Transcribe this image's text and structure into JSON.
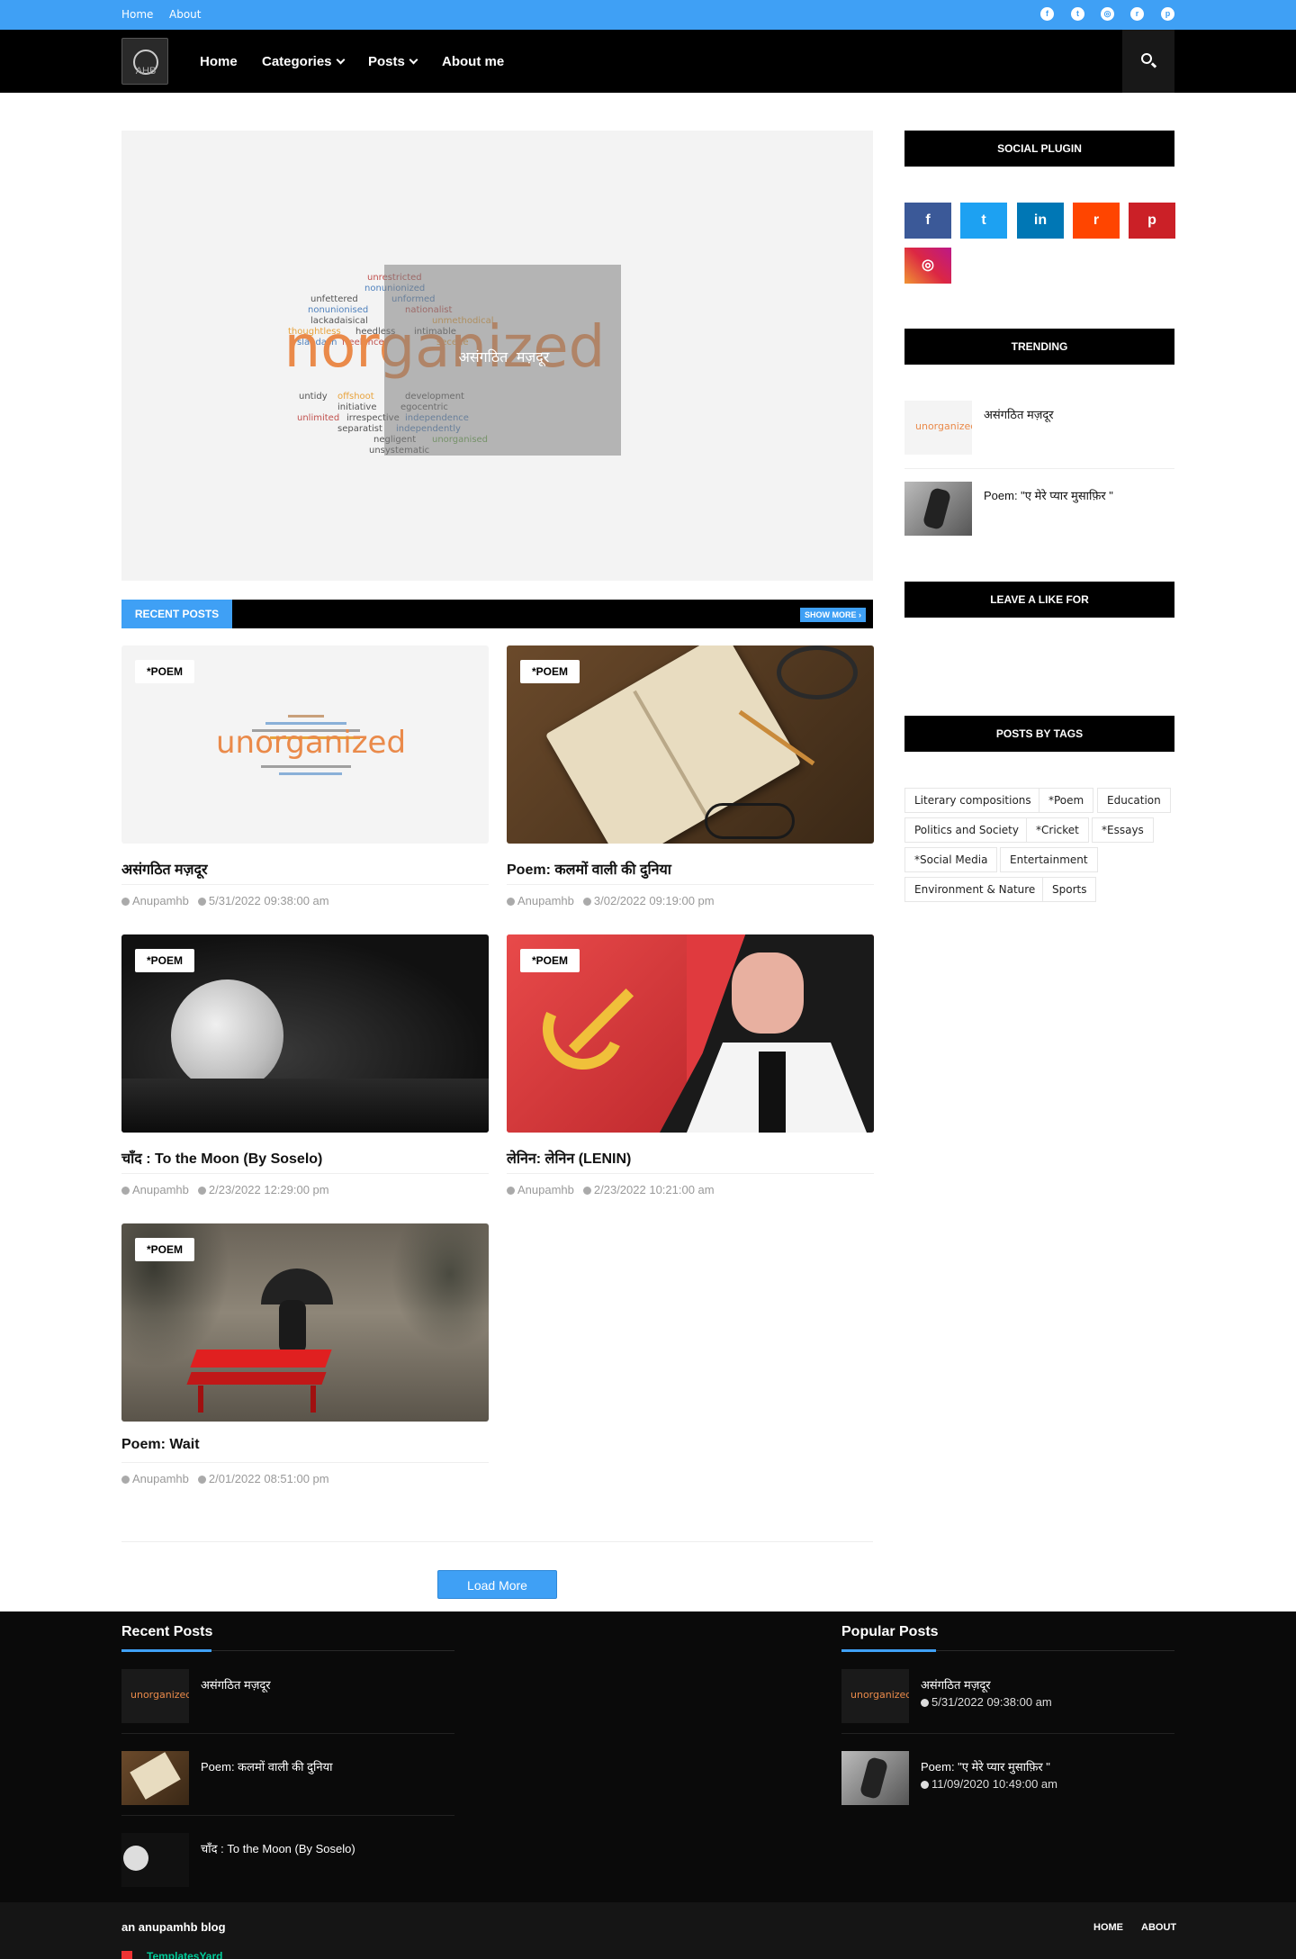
{
  "topbar": {
    "links": [
      "Home",
      "About"
    ],
    "social_icons": [
      "facebook-icon",
      "twitter-icon",
      "instagram-icon",
      "reddit-icon",
      "pinterest-icon"
    ],
    "accent": "#3fa0f5"
  },
  "nav": {
    "logo_text": "AHB",
    "items": [
      "Home",
      "Categories",
      "Posts",
      "About me"
    ],
    "search_icon": "search-icon"
  },
  "hero": {
    "title": "असंगठित मज़दूर",
    "word_cloud_main": "unorganized"
  },
  "recent_section": {
    "label": "RECENT POSTS",
    "show_more": "SHOW MORE ›"
  },
  "posts": [
    {
      "tag": "*POEM",
      "title": "असंगठित मज़दूर",
      "author": "Anupamhb",
      "date": "5/31/2022 09:38:00 am"
    },
    {
      "tag": "*POEM",
      "title": "Poem: कलमों वाली की दुनिया",
      "author": "Anupamhb",
      "date": "3/02/2022 09:19:00 pm"
    },
    {
      "tag": "*POEM",
      "title": "चाँद : To the Moon (By Soselo)",
      "author": "Anupamhb",
      "date": "2/23/2022 12:29:00 pm"
    },
    {
      "tag": "*POEM",
      "title": "लेनिन: लेनिन (LENIN)",
      "author": "Anupamhb",
      "date": "2/23/2022 10:21:00 am"
    },
    {
      "tag": "*POEM",
      "title": "Poem: Wait",
      "author": "Anupamhb",
      "date": "2/01/2022 08:51:00 pm"
    }
  ],
  "load_more": "Load More",
  "sidebar": {
    "social_plugin": "SOCIAL PLUGIN",
    "social_buttons": [
      {
        "icon": "facebook-icon",
        "glyph": "f",
        "color": "#3b5998"
      },
      {
        "icon": "twitter-icon",
        "glyph": "t",
        "color": "#1da1f2"
      },
      {
        "icon": "linkedin-icon",
        "glyph": "in",
        "color": "#0077b5"
      },
      {
        "icon": "reddit-icon",
        "glyph": "r",
        "color": "#ff4500"
      },
      {
        "icon": "pinterest-icon",
        "glyph": "p",
        "color": "#cb2027"
      },
      {
        "icon": "instagram-icon",
        "glyph": "◎",
        "color": "#c13584"
      }
    ],
    "trending": "TRENDING",
    "trending_items": [
      "असंगठित मज़दूर",
      "Poem: \"ए मेरे प्यार मुसाफ़िर \""
    ],
    "leave_like": "LEAVE A LIKE FOR",
    "posts_by_tags": "POSTS BY TAGS",
    "tags": [
      "Literary compositions",
      "*Poem",
      "Education",
      "Politics and Society",
      "*Cricket",
      "*Essays",
      "*Social Media",
      "Entertainment",
      "Environment & Nature",
      "Sports"
    ]
  },
  "footer": {
    "recent_title": "Recent Posts",
    "recent_items": [
      "असंगठित मज़दूर",
      "Poem: कलमों वाली की दुनिया",
      "चाँद : To the Moon (By Soselo)"
    ],
    "popular_title": "Popular Posts",
    "popular_items": [
      {
        "title": "असंगठित मज़दूर",
        "date": "5/31/2022 09:38:00 am"
      },
      {
        "title": "Poem: \"ए मेरे प्यार मुसाफ़िर \"",
        "date": "11/09/2020 10:49:00 am"
      }
    ]
  },
  "bottom": {
    "blog_name": "an anupamhb blog",
    "links": [
      "HOME",
      "ABOUT"
    ],
    "credit": "TemplatesYard"
  }
}
